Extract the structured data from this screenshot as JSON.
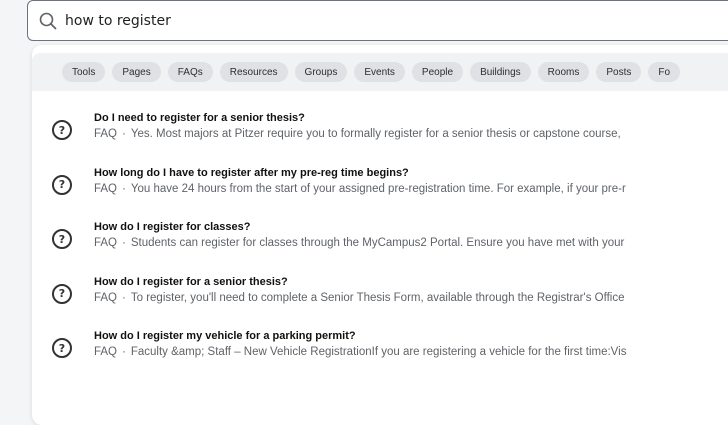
{
  "search": {
    "value": "how to register"
  },
  "filters": [
    "Tools",
    "Pages",
    "FAQs",
    "Resources",
    "Groups",
    "Events",
    "People",
    "Buildings",
    "Rooms",
    "Posts",
    "Fo"
  ],
  "results": [
    {
      "title": "Do I need to register for a senior thesis?",
      "type": "FAQ",
      "separator": "·",
      "snippet": "Yes. Most majors at Pitzer require you to formally register for a senior thesis or capstone course,",
      "icon": "question-circle-icon"
    },
    {
      "title": "How long do I have to register after my pre-reg time begins?",
      "type": "FAQ",
      "separator": "·",
      "snippet": "You have 24 hours from the start of your assigned pre-registration time. For example, if your pre-r",
      "icon": "question-circle-icon"
    },
    {
      "title": "How do I register for classes?",
      "type": "FAQ",
      "separator": "·",
      "snippet": "Students can register for classes through the MyCampus2 Portal. Ensure you have met with your",
      "icon": "question-circle-icon"
    },
    {
      "title": "How do I register for a senior thesis?",
      "type": "FAQ",
      "separator": "·",
      "snippet": "To register, you'll need to complete a Senior Thesis Form, available through the Registrar's Office",
      "icon": "question-circle-icon"
    },
    {
      "title": "How do I register my vehicle for a parking permit?",
      "type": "FAQ",
      "separator": "·",
      "snippet": "Faculty &amp; Staff – New Vehicle RegistrationIf you are registering a vehicle for the first time:Vis",
      "icon": "question-circle-icon"
    }
  ],
  "colors": {
    "page_bg": "#f4f5f7",
    "chip_bg": "#dfe1e4",
    "border": "#6b7280",
    "muted_text": "#5f6368"
  }
}
